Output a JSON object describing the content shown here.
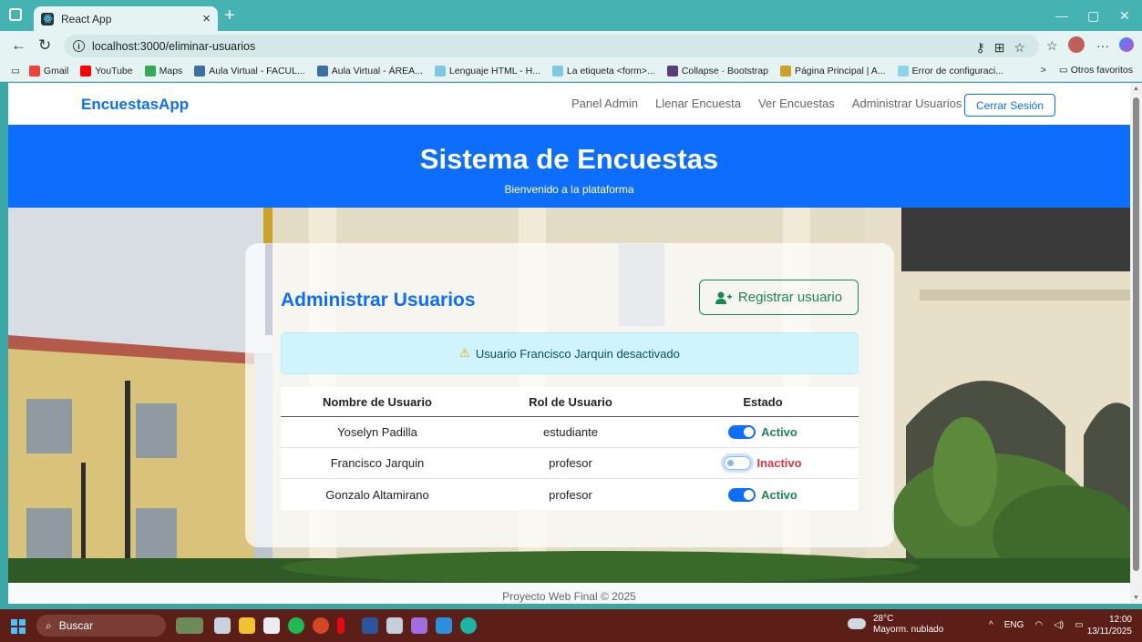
{
  "browser": {
    "tab_title": "React App",
    "tab_close": "×",
    "new_tab": "+",
    "url": "localhost:3000/eliminar-usuarios",
    "window_controls": [
      "—",
      "▢",
      "✕"
    ],
    "bookmarks": [
      {
        "label": "Gmail",
        "color": "#ea4335"
      },
      {
        "label": "YouTube",
        "color": "#ff0000"
      },
      {
        "label": "Maps",
        "color": "#34a853"
      },
      {
        "label": "Aula Virtual - FACUL...",
        "color": "#3a6ea5"
      },
      {
        "label": "Aula Virtual - ÁREA...",
        "color": "#3a6ea5"
      },
      {
        "label": "Lenguaje HTML - H...",
        "color": "#7ec8e3"
      },
      {
        "label": "La etiqueta <form>...",
        "color": "#7ec8e3"
      },
      {
        "label": "Collapse · Bootstrap",
        "color": "#563d7c"
      },
      {
        "label": "Página Principal | A...",
        "color": "#c9a227"
      },
      {
        "label": "Error de configuraci...",
        "color": "#8fd3e8"
      }
    ],
    "other_favorites": "Otros favoritos",
    "more_chevron": ">"
  },
  "app": {
    "brand": "EncuestasApp",
    "nav": [
      "Panel Admin",
      "Llenar Encuesta",
      "Ver Encuestas",
      "Administrar Usuarios"
    ],
    "logout": "Cerrar Sesión",
    "hero_title": "Sistema de Encuestas",
    "hero_subtitle": "Bienvenido a la plataforma",
    "card_title": "Administrar Usuarios",
    "register_button": "Registrar usuario",
    "alert_text": "Usuario Francisco Jarquin desactivado",
    "table": {
      "headers": [
        "Nombre de Usuario",
        "Rol de Usuario",
        "Estado"
      ],
      "rows": [
        {
          "name": "Yoselyn Padilla",
          "role": "estudiante",
          "status": "Activo",
          "active": true
        },
        {
          "name": "Francisco Jarquin",
          "role": "profesor",
          "status": "Inactivo",
          "active": false
        },
        {
          "name": "Gonzalo Altamirano",
          "role": "profesor",
          "status": "Activo",
          "active": true
        }
      ]
    },
    "footer": "Proyecto Web Final © 2025"
  },
  "taskbar": {
    "search": "Buscar",
    "weather_temp": "28°C",
    "weather_desc": "Mayorm. nublado",
    "language": "ENG",
    "time": "12:00",
    "date": "13/11/2025"
  }
}
